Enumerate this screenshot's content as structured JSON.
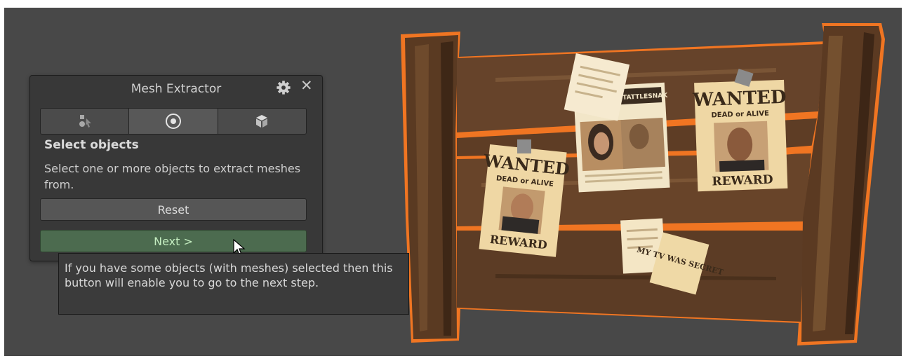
{
  "panel": {
    "title": "Mesh Extractor",
    "tabs": [
      {
        "icon": "select-objects-icon",
        "active": false
      },
      {
        "icon": "target-icon",
        "active": true
      },
      {
        "icon": "cube-icon",
        "active": false
      }
    ],
    "heading": "Select objects",
    "description": "Select one or more objects to extract meshes from.",
    "reset_label": "Reset",
    "next_label": "Next >"
  },
  "tooltip": {
    "text": "If you have some objects (with meshes) selected then this button will enable you to go to the next step."
  },
  "scene": {
    "selection_color": "#f07522",
    "posters": [
      {
        "title": "WANTED",
        "sub": "DEAD or ALIVE",
        "footer": "REWARD"
      },
      {
        "title": "WANTED",
        "sub": "DEAD or ALIVE",
        "footer": "REWARD"
      }
    ],
    "newspaper_header": "THE TATTLESNAK",
    "note_text": "MY TV WAS SECRET"
  },
  "colors": {
    "viewport_bg": "#484848",
    "panel_bg": "#383838",
    "next_button_bg": "#4c6b4f",
    "next_button_text": "#c4edc0"
  }
}
